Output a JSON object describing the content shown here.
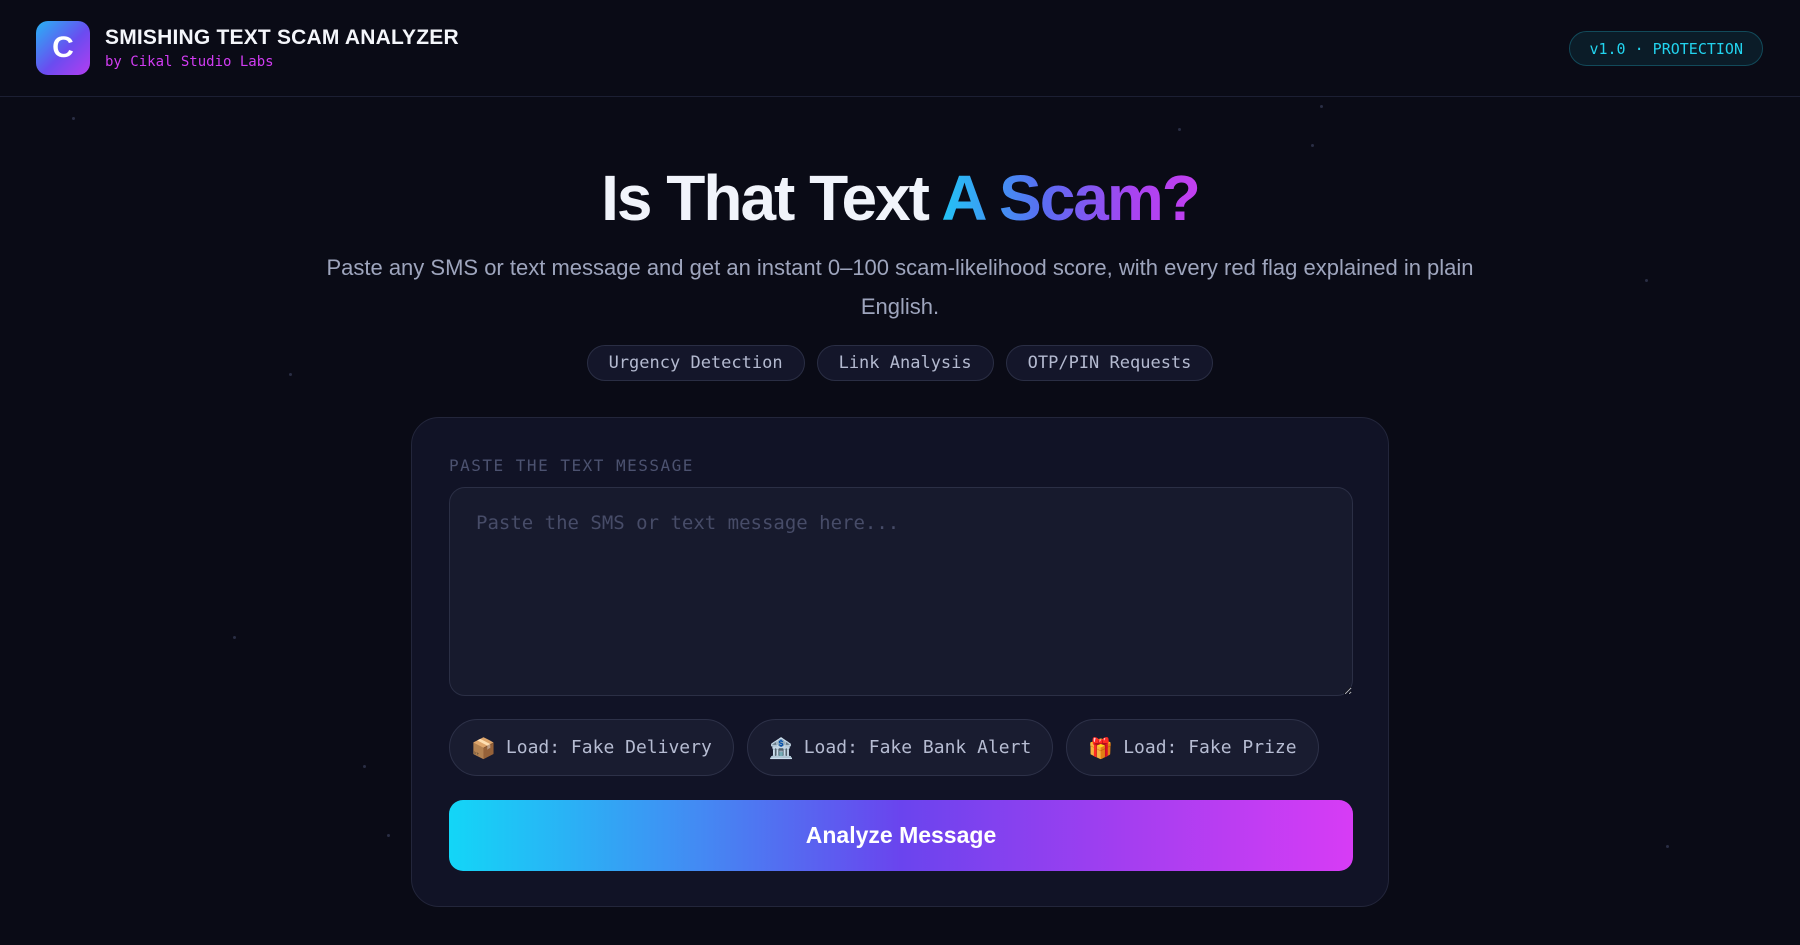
{
  "header": {
    "logo_letter": "C",
    "title": "SMISHING TEXT SCAM ANALYZER",
    "subtitle": "by Cikal Studio Labs",
    "version_badge": "v1.0 · PROTECTION"
  },
  "hero": {
    "title_plain": "Is That Text ",
    "title_accent": "A Scam?",
    "description": "Paste any SMS or text message and get an instant 0–100 scam-likelihood score, with every red flag explained in plain English.",
    "tags": [
      "Urgency Detection",
      "Link Analysis",
      "OTP/PIN Requests"
    ]
  },
  "analyzer": {
    "field_label": "PASTE THE TEXT MESSAGE",
    "input_value": "",
    "input_placeholder": "Paste the SMS or text message here...",
    "samples": [
      {
        "icon": "package-icon",
        "emoji": "📦",
        "label": "Load: Fake Delivery"
      },
      {
        "icon": "bank-icon",
        "emoji": "🏦",
        "label": "Load: Fake Bank Alert"
      },
      {
        "icon": "gift-icon",
        "emoji": "🎁",
        "label": "Load: Fake Prize"
      }
    ],
    "analyze_label": "Analyze Message"
  },
  "colors": {
    "background": "#0a0b16",
    "accent_cyan": "#22d3ee",
    "accent_magenta": "#d13cf2",
    "card": "#111326"
  }
}
